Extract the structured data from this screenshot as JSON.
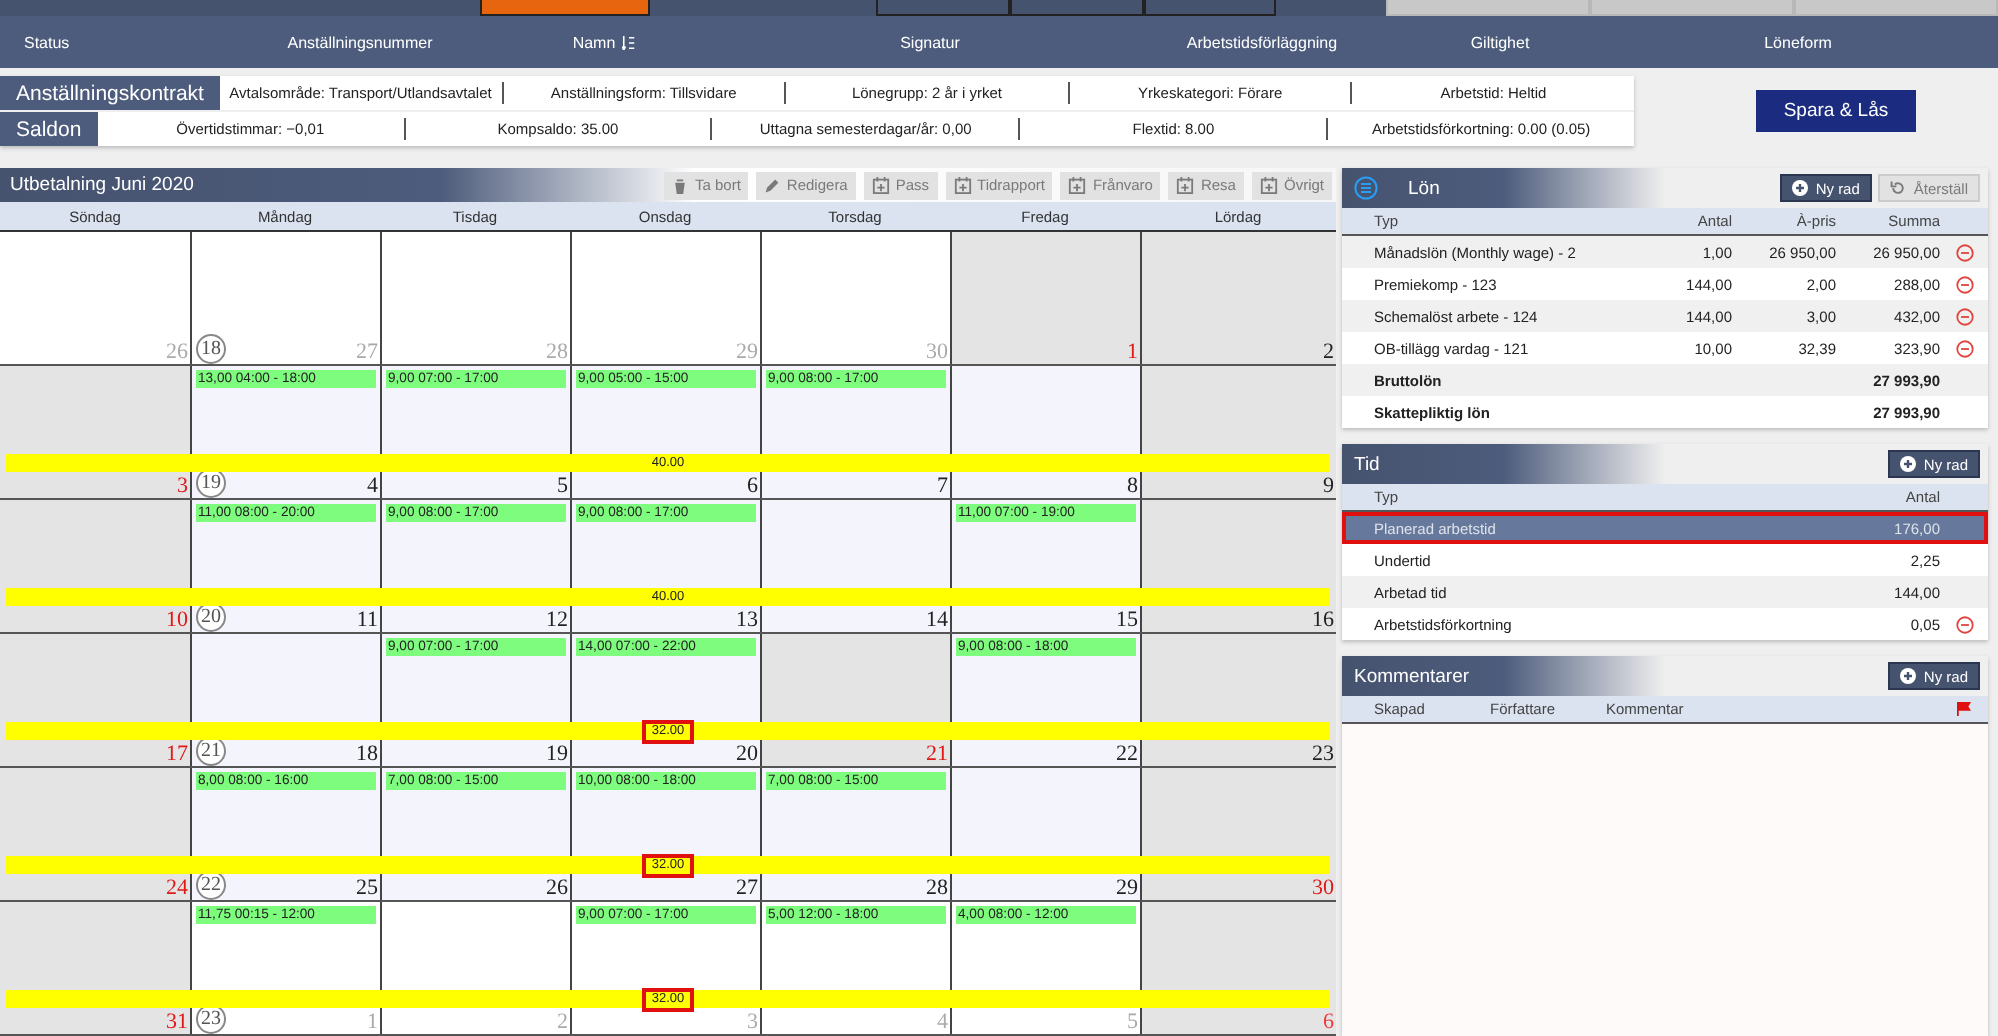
{
  "top_buttons": [
    {
      "kind": "accent"
    },
    {
      "kind": "dark"
    },
    {
      "kind": "dark"
    },
    {
      "kind": "dark"
    },
    {
      "kind": "disabled"
    },
    {
      "kind": "disabled"
    },
    {
      "kind": "disabled"
    }
  ],
  "header_columns": [
    {
      "label": "Status",
      "sortable": false
    },
    {
      "label": "Anställningsnummer",
      "sortable": false
    },
    {
      "label": "Namn",
      "sortable": true
    },
    {
      "label": "Signatur",
      "sortable": false
    },
    {
      "label": "Arbetstidsförläggning",
      "sortable": false
    },
    {
      "label": "Giltighet",
      "sortable": false
    },
    {
      "label": "Löneform",
      "sortable": false
    }
  ],
  "contract": {
    "label": "Anställningskontrakt",
    "fields": [
      "Avtalsområde: Transport/Utlandsavtalet",
      "Anställningsform: Tillsvidare",
      "Lönegrupp: 2 år i yrket",
      "Yrkeskategori: Förare",
      "Arbetstid: Heltid"
    ]
  },
  "balances": {
    "label": "Saldon",
    "fields": [
      "Övertidstimmar: −0,01",
      "Kompsaldo: 35.00",
      "Uttagna semesterdagar/år: 0,00",
      "Flextid: 8.00",
      "Arbetstidsförkortning: 0.00 (0.05)"
    ]
  },
  "save_button": "Spara & Lås",
  "calendar": {
    "title": "Utbetalning Juni 2020",
    "toolbar": [
      {
        "label": "Ta bort",
        "kind": "delete",
        "disabled": true
      },
      {
        "label": "Redigera",
        "kind": "edit",
        "disabled": true
      },
      {
        "label": "Pass",
        "kind": "add",
        "disabled": true
      },
      {
        "label": "Tidrapport",
        "kind": "add",
        "disabled": true
      },
      {
        "label": "Frånvaro",
        "kind": "add",
        "disabled": true
      },
      {
        "label": "Resa",
        "kind": "add",
        "disabled": true
      },
      {
        "label": "Övrigt",
        "kind": "add",
        "disabled": true
      }
    ],
    "weekdays": [
      "Söndag",
      "Måndag",
      "Tisdag",
      "Onsdag",
      "Torsdag",
      "Fredag",
      "Lördag"
    ],
    "weeks": [
      {
        "week_number": "18",
        "days": [
          {
            "number": "26",
            "kind": "plain",
            "holiday": false,
            "other_month": true
          },
          {
            "number": "27",
            "kind": "plain",
            "holiday": false,
            "other_month": true
          },
          {
            "number": "28",
            "kind": "plain",
            "holiday": false,
            "other_month": true
          },
          {
            "number": "29",
            "kind": "plain",
            "holiday": false,
            "other_month": true
          },
          {
            "number": "30",
            "kind": "plain",
            "holiday": false,
            "other_month": true
          },
          {
            "number": "1",
            "kind": "off",
            "holiday": true,
            "other_month": false
          },
          {
            "number": "2",
            "kind": "off",
            "holiday": false,
            "other_month": false
          }
        ]
      },
      {
        "week_number": "19",
        "total": "40.00",
        "flagged": false,
        "days": [
          {
            "number": "3",
            "kind": "off",
            "holiday": true,
            "other_month": false
          },
          {
            "number": "4",
            "kind": "scheduled",
            "holiday": false,
            "other_month": false,
            "events": [
              "13,00 04:00 - 18:00"
            ]
          },
          {
            "number": "5",
            "kind": "scheduled",
            "holiday": false,
            "other_month": false,
            "events": [
              "9,00 07:00 - 17:00"
            ]
          },
          {
            "number": "6",
            "kind": "scheduled",
            "holiday": false,
            "other_month": false,
            "events": [
              "9,00 05:00 - 15:00"
            ]
          },
          {
            "number": "7",
            "kind": "scheduled",
            "holiday": false,
            "other_month": false,
            "events": [
              "9,00 08:00 - 17:00"
            ]
          },
          {
            "number": "8",
            "kind": "scheduled",
            "holiday": false,
            "other_month": false
          },
          {
            "number": "9",
            "kind": "off",
            "holiday": false,
            "other_month": false
          }
        ]
      },
      {
        "week_number": "20",
        "total": "40.00",
        "flagged": false,
        "days": [
          {
            "number": "10",
            "kind": "off",
            "holiday": true,
            "other_month": false
          },
          {
            "number": "11",
            "kind": "scheduled",
            "holiday": false,
            "other_month": false,
            "events": [
              "11,00 08:00 - 20:00"
            ]
          },
          {
            "number": "12",
            "kind": "scheduled",
            "holiday": false,
            "other_month": false,
            "events": [
              "9,00 08:00 - 17:00"
            ]
          },
          {
            "number": "13",
            "kind": "scheduled",
            "holiday": false,
            "other_month": false,
            "events": [
              "9,00 08:00 - 17:00"
            ]
          },
          {
            "number": "14",
            "kind": "scheduled",
            "holiday": false,
            "other_month": false
          },
          {
            "number": "15",
            "kind": "scheduled",
            "holiday": false,
            "other_month": false,
            "events": [
              "11,00 07:00 - 19:00"
            ]
          },
          {
            "number": "16",
            "kind": "off",
            "holiday": false,
            "other_month": false
          }
        ]
      },
      {
        "week_number": "21",
        "total": "32.00",
        "flagged": true,
        "days": [
          {
            "number": "17",
            "kind": "off",
            "holiday": true,
            "other_month": false
          },
          {
            "number": "18",
            "kind": "scheduled",
            "holiday": false,
            "other_month": false
          },
          {
            "number": "19",
            "kind": "scheduled",
            "holiday": false,
            "other_month": false,
            "events": [
              "9,00 07:00 - 17:00"
            ]
          },
          {
            "number": "20",
            "kind": "scheduled",
            "holiday": false,
            "other_month": false,
            "events": [
              "14,00 07:00 - 22:00"
            ]
          },
          {
            "number": "21",
            "kind": "off",
            "holiday": true,
            "other_month": false
          },
          {
            "number": "22",
            "kind": "scheduled",
            "holiday": false,
            "other_month": false,
            "events": [
              "9,00 08:00 - 18:00"
            ]
          },
          {
            "number": "23",
            "kind": "off",
            "holiday": false,
            "other_month": false
          }
        ]
      },
      {
        "week_number": "22",
        "total": "32.00",
        "flagged": true,
        "days": [
          {
            "number": "24",
            "kind": "off",
            "holiday": true,
            "other_month": false
          },
          {
            "number": "25",
            "kind": "scheduled",
            "holiday": false,
            "other_month": false,
            "events": [
              "8,00 08:00 - 16:00"
            ]
          },
          {
            "number": "26",
            "kind": "scheduled",
            "holiday": false,
            "other_month": false,
            "events": [
              "7,00 08:00 - 15:00"
            ]
          },
          {
            "number": "27",
            "kind": "scheduled",
            "holiday": false,
            "other_month": false,
            "events": [
              "10,00 08:00 - 18:00"
            ]
          },
          {
            "number": "28",
            "kind": "scheduled",
            "holiday": false,
            "other_month": false,
            "events": [
              "7,00 08:00 - 15:00"
            ]
          },
          {
            "number": "29",
            "kind": "scheduled",
            "holiday": false,
            "other_month": false
          },
          {
            "number": "30",
            "kind": "off",
            "holiday": true,
            "other_month": false
          }
        ]
      },
      {
        "week_number": "23",
        "total": "32.00",
        "flagged": true,
        "days": [
          {
            "number": "31",
            "kind": "off",
            "holiday": true,
            "other_month": false
          },
          {
            "number": "1",
            "kind": "plain",
            "holiday": false,
            "other_month": true,
            "events": [
              "11,75 00:15 - 12:00"
            ]
          },
          {
            "number": "2",
            "kind": "plain",
            "holiday": false,
            "other_month": true
          },
          {
            "number": "3",
            "kind": "plain",
            "holiday": false,
            "other_month": true,
            "events": [
              "9,00 07:00 - 17:00"
            ]
          },
          {
            "number": "4",
            "kind": "plain",
            "holiday": false,
            "other_month": true,
            "events": [
              "5,00 12:00 - 18:00"
            ]
          },
          {
            "number": "5",
            "kind": "plain",
            "holiday": false,
            "other_month": true,
            "events": [
              "4,00 08:00 - 12:00"
            ]
          },
          {
            "number": "6",
            "kind": "off",
            "holiday": true,
            "other_month": true
          }
        ]
      }
    ]
  },
  "salary": {
    "title": "Lön",
    "buttons": [
      {
        "label": "Ny rad",
        "kind": "add",
        "disabled": false
      },
      {
        "label": "Återställ",
        "kind": "reset",
        "disabled": true
      }
    ],
    "columns": [
      "Typ",
      "Antal",
      "À-pris",
      "Summa"
    ],
    "rows": [
      {
        "kind": "item",
        "type": "Månadslön (Monthly wage) - 2",
        "antal": "1,00",
        "apris": "26 950,00",
        "summa": "26 950,00",
        "removable": true
      },
      {
        "kind": "item",
        "type": "Premiekomp - 123",
        "antal": "144,00",
        "apris": "2,00",
        "summa": "288,00",
        "removable": true
      },
      {
        "kind": "item",
        "type": "Schemalöst arbete - 124",
        "antal": "144,00",
        "apris": "3,00",
        "summa": "432,00",
        "removable": true
      },
      {
        "kind": "item",
        "type": "OB-tillägg vardag - 121",
        "antal": "10,00",
        "apris": "32,39",
        "summa": "323,90",
        "removable": true
      },
      {
        "kind": "total",
        "type": "Bruttolön",
        "summa": "27 993,90",
        "removable": false
      },
      {
        "kind": "total",
        "type": "Skattepliktig lön",
        "summa": "27 993,90",
        "removable": false
      }
    ]
  },
  "time": {
    "title": "Tid",
    "buttons": [
      {
        "label": "Ny rad",
        "kind": "add",
        "disabled": false
      }
    ],
    "columns": [
      "Typ",
      "Antal"
    ],
    "rows": [
      {
        "type": "Planerad arbetstid",
        "antal": "176,00",
        "selected": true,
        "removable": false
      },
      {
        "type": "Undertid",
        "antal": "2,25",
        "selected": false,
        "removable": false
      },
      {
        "type": "Arbetad tid",
        "antal": "144,00",
        "selected": false,
        "removable": false
      },
      {
        "type": "Arbetstidsförkortning",
        "antal": "0,05",
        "selected": false,
        "removable": true
      }
    ]
  },
  "comments": {
    "title": "Kommentarer",
    "buttons": [
      {
        "label": "Ny rad",
        "kind": "add",
        "disabled": false
      }
    ],
    "columns": [
      "Skapad",
      "Författare",
      "Kommentar"
    ]
  }
}
